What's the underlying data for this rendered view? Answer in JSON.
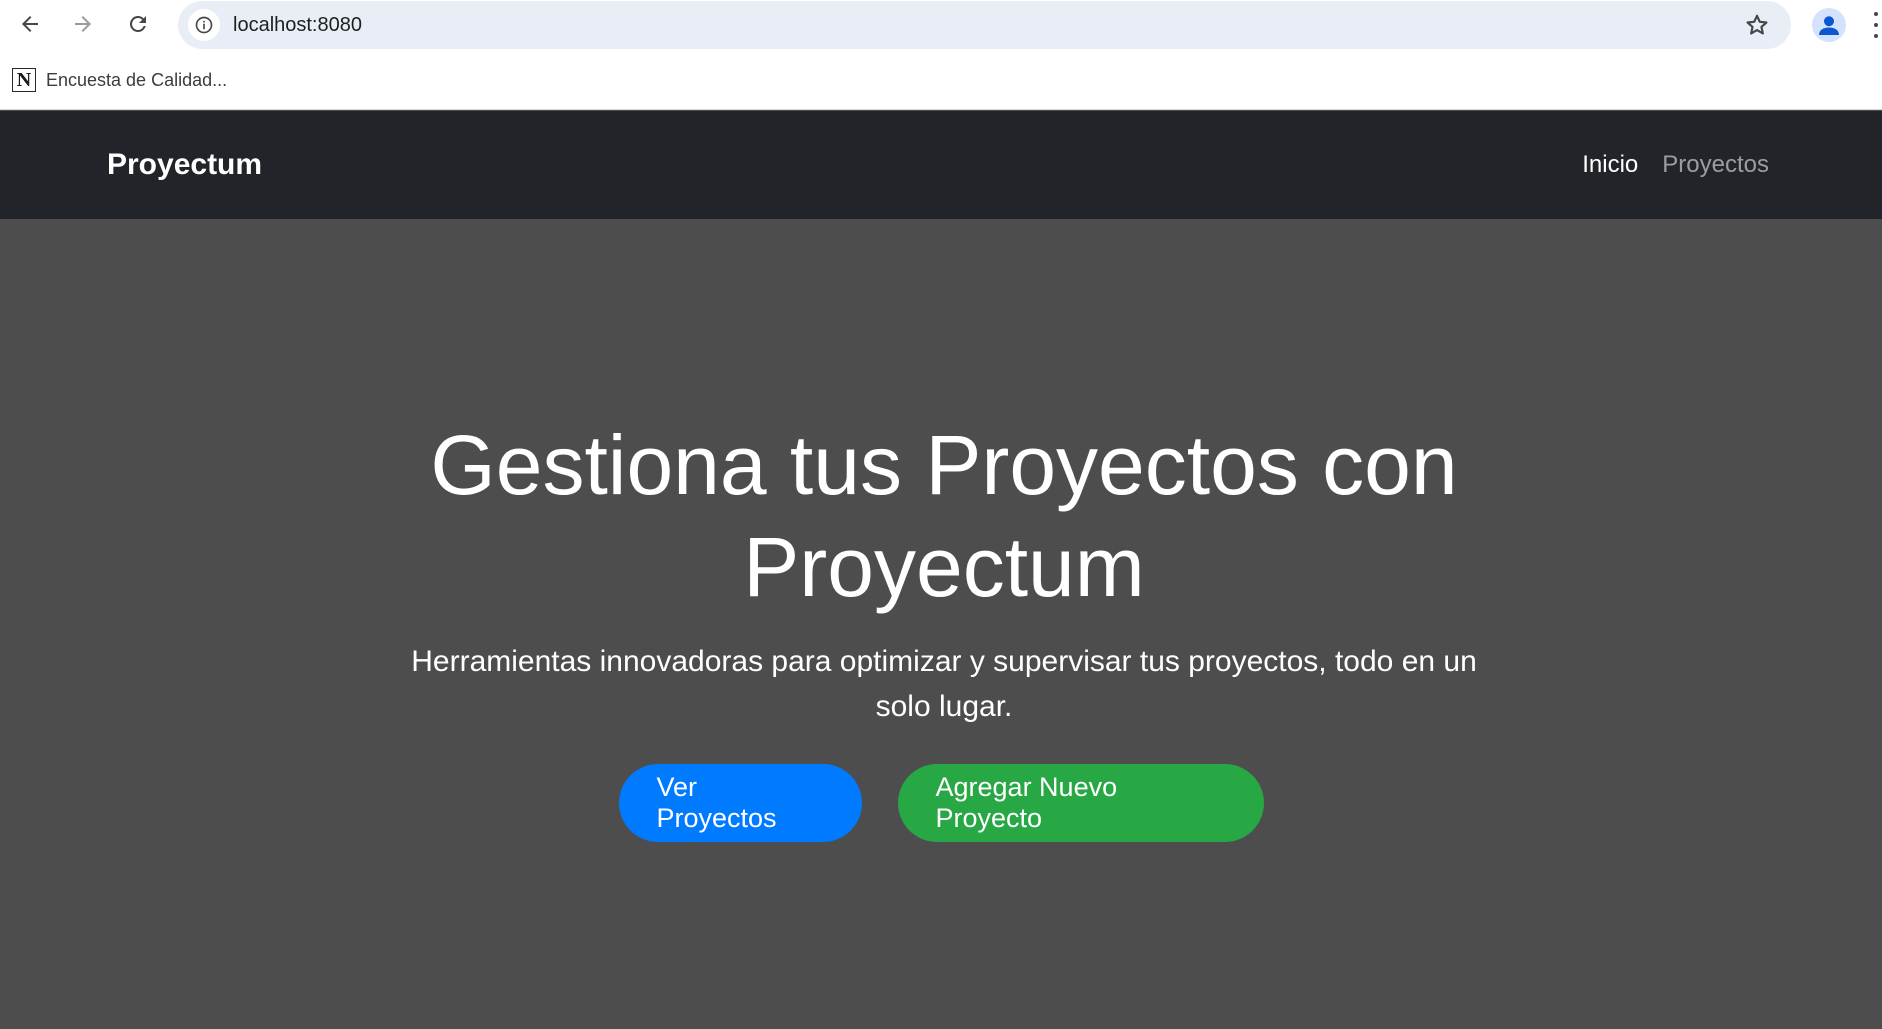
{
  "browser": {
    "url": "localhost:8080",
    "bookmarks": [
      {
        "label": "Encuesta de Calidad...",
        "icon": "notion-icon",
        "icon_letter": "N"
      }
    ],
    "icons": {
      "back": "back-arrow-icon",
      "forward": "forward-arrow-icon",
      "reload": "reload-icon",
      "info": "info-icon",
      "star": "star-icon",
      "profile": "profile-icon",
      "menu": "more-menu-icon"
    }
  },
  "navbar": {
    "brand": "Proyectum",
    "links": [
      {
        "label": "Inicio",
        "active": true
      },
      {
        "label": "Proyectos",
        "active": false
      }
    ],
    "background_color": "#212529"
  },
  "hero": {
    "title": "Gestiona tus Proyectos con Proyectum",
    "subtitle": "Herramientas innovadoras para optimizar y supervisar tus proyectos, todo en un solo lugar.",
    "buttons": [
      {
        "label": "Ver Proyectos",
        "color": "#007bff"
      },
      {
        "label": "Agregar Nuevo Proyecto",
        "color": "#28a745"
      }
    ],
    "background_color": "#4d4d4d"
  }
}
